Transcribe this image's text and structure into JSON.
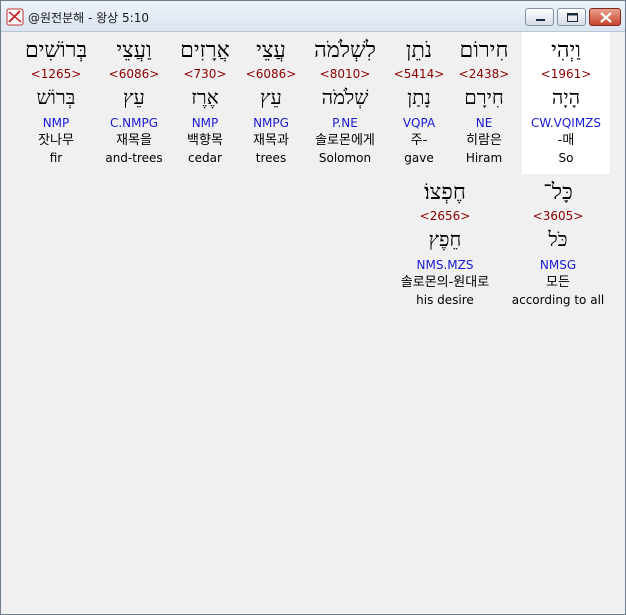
{
  "window": {
    "title": "@원전분해 - 왕상 5:10"
  },
  "rows": [
    [
      {
        "hebrew": "בְּרוֹשִׁים",
        "strong": "<1265>",
        "lemma": "בְּרוֹשׁ",
        "morph": "NMP",
        "korean": "잣나무",
        "english": "fir"
      },
      {
        "hebrew": "וַעֲצֵי",
        "strong": "<6086>",
        "lemma": "עֵץ",
        "morph": "C.NMPG",
        "korean": "재목을",
        "english": "and-trees"
      },
      {
        "hebrew": "אֲרָזִים",
        "strong": "<730>",
        "lemma": "אֶרֶז",
        "morph": "NMP",
        "korean": "백향목",
        "english": "cedar"
      },
      {
        "hebrew": "עֲצֵי",
        "strong": "<6086>",
        "lemma": "עֵץ",
        "morph": "NMPG",
        "korean": "재목과",
        "english": "trees"
      },
      {
        "hebrew": "לִשְׁלֹמֹה",
        "strong": "<8010>",
        "lemma": "שְׁלֹמֹה",
        "morph": "P.NE",
        "korean": "솔로몬에게",
        "english": "Solomon"
      },
      {
        "hebrew": "נֹתֵן",
        "strong": "<5414>",
        "lemma": "נָתַן",
        "morph": "VQPA",
        "korean": "주-",
        "english": "gave"
      },
      {
        "hebrew": "חִירוֹם",
        "strong": "<2438>",
        "lemma": "חִירָם",
        "morph": "NE",
        "korean": "히람은",
        "english": "Hiram"
      },
      {
        "hebrew": "וַיְהִי",
        "strong": "<1961>",
        "lemma": "הָיָה",
        "morph": "CW.VQIMZS",
        "korean": "-매",
        "english": "So",
        "selected": true
      }
    ],
    [
      {
        "hebrew": "חֶפְצוֹ׃",
        "strong": "<2656>",
        "lemma": "חֵפֶץ",
        "morph": "NMS.MZS",
        "korean": "솔로몬의-원대로",
        "english": "his desire"
      },
      {
        "hebrew": "כָּל־",
        "strong": "<3605>",
        "lemma": "כֹּל",
        "morph": "NMSG",
        "korean": "모든",
        "english": "according to all"
      }
    ]
  ]
}
